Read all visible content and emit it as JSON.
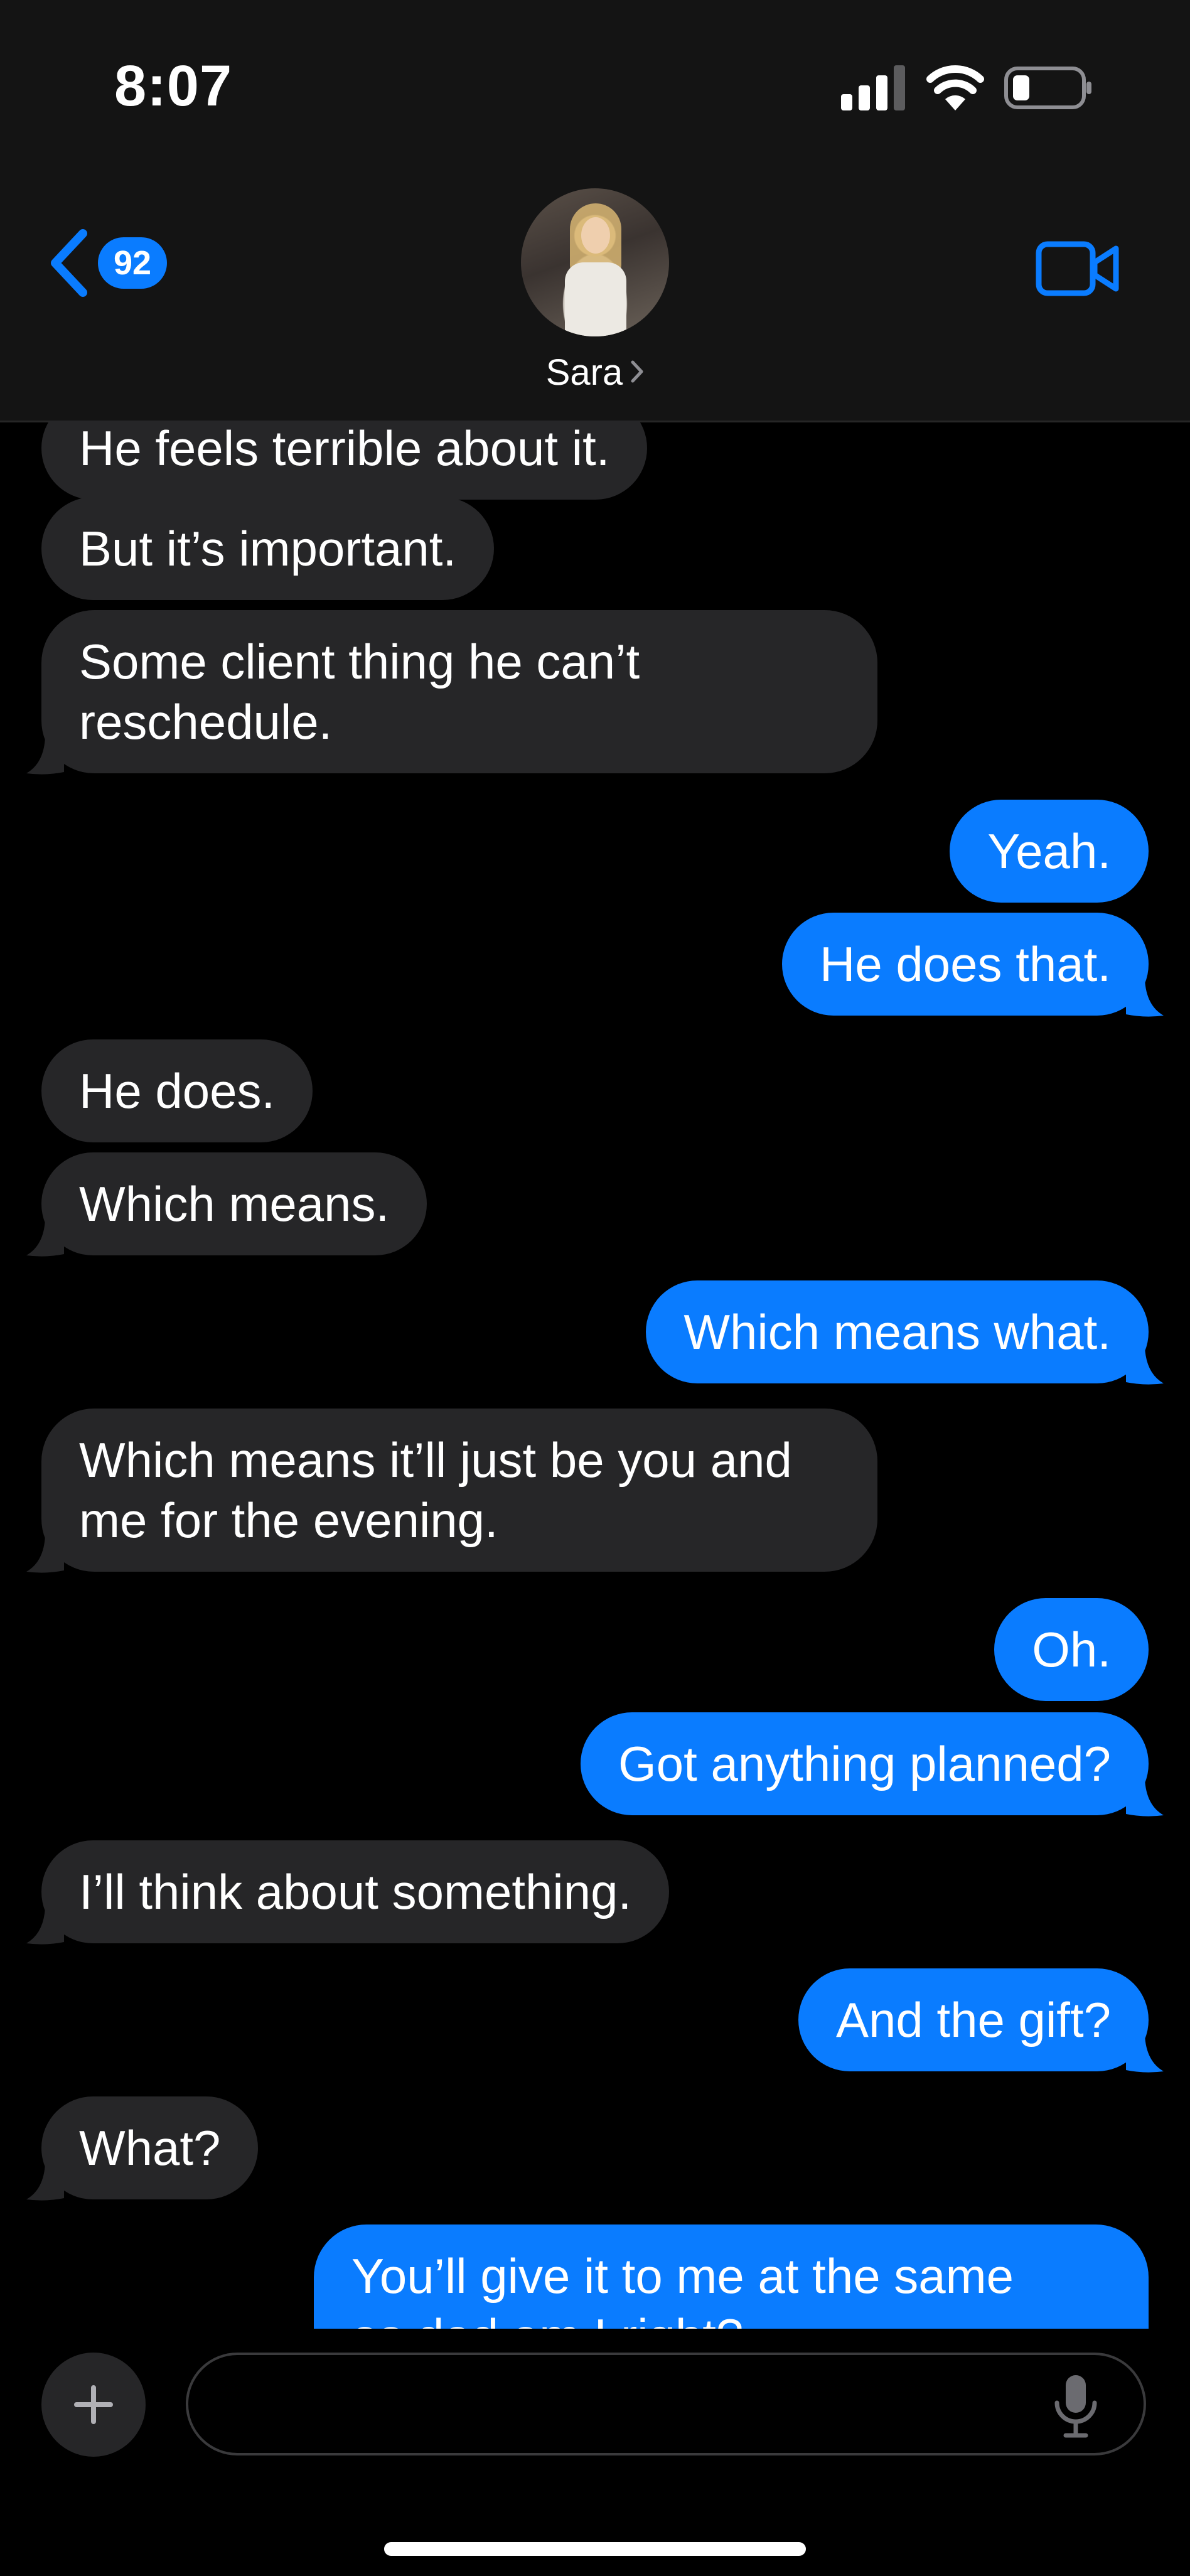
{
  "status_bar": {
    "time": "8:07"
  },
  "header": {
    "unread_count": "92",
    "contact_name": "Sara"
  },
  "messages": [
    {
      "sender": "contact",
      "lines": [
        "He feels terrible about it."
      ]
    },
    {
      "sender": "contact",
      "lines": [
        "But it’s important."
      ]
    },
    {
      "sender": "contact",
      "lines": [
        "Some client thing he can’t",
        "reschedule."
      ]
    },
    {
      "sender": "me",
      "lines": [
        "Yeah."
      ]
    },
    {
      "sender": "me",
      "lines": [
        "He does that."
      ]
    },
    {
      "sender": "contact",
      "lines": [
        "He does."
      ]
    },
    {
      "sender": "contact",
      "lines": [
        "Which means."
      ]
    },
    {
      "sender": "me",
      "lines": [
        "Which means what."
      ]
    },
    {
      "sender": "contact",
      "lines": [
        "Which means it’ll just be you and",
        "me for the evening."
      ]
    },
    {
      "sender": "me",
      "lines": [
        "Oh."
      ]
    },
    {
      "sender": "me",
      "lines": [
        "Got anything planned?"
      ]
    },
    {
      "sender": "contact",
      "lines": [
        "I’ll think about something."
      ]
    },
    {
      "sender": "me",
      "lines": [
        "And the gift?"
      ]
    },
    {
      "sender": "contact",
      "lines": [
        "What?"
      ]
    },
    {
      "sender": "me",
      "lines": [
        "You’ll give it to me at the same",
        "as dad am I right?"
      ]
    }
  ],
  "compose": {
    "placeholder": "",
    "value": ""
  },
  "colors": {
    "outgoing": "#0a7cff",
    "incoming": "#262628",
    "background": "#000000",
    "header": "#141414"
  }
}
